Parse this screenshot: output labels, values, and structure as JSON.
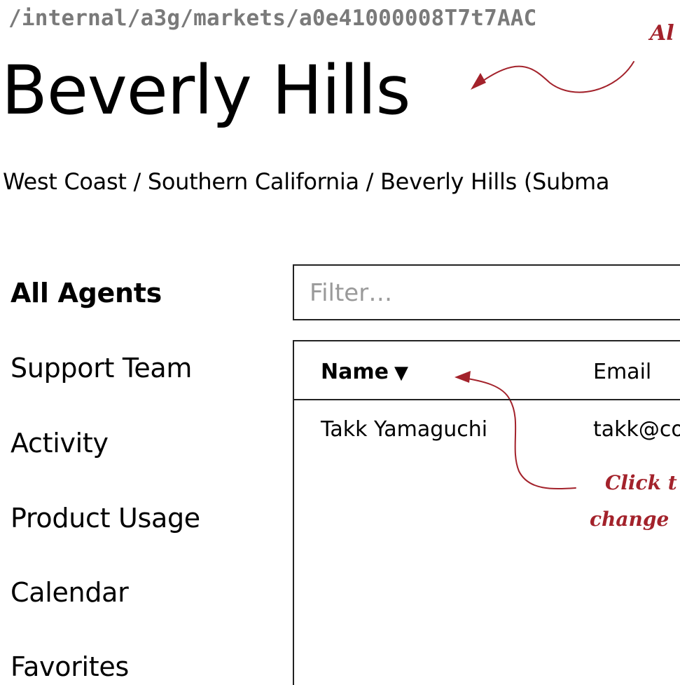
{
  "url_path": "/internal/a3g/markets/a0e41000008T7t7AAC",
  "page_title": "Beverly Hills",
  "breadcrumb": "West Coast / Southern California / Beverly Hills (Subma",
  "annotations": {
    "top": "Al",
    "click_line1": "Click t",
    "click_line2": "change"
  },
  "sidebar": {
    "items": [
      {
        "label": "All Agents",
        "active": true
      },
      {
        "label": "Support Team",
        "active": false
      },
      {
        "label": "Activity",
        "active": false
      },
      {
        "label": "Product Usage",
        "active": false
      },
      {
        "label": "Calendar",
        "active": false
      },
      {
        "label": "Favorites",
        "active": false
      }
    ]
  },
  "filter": {
    "placeholder": "Filter…",
    "value": ""
  },
  "table": {
    "columns": [
      {
        "label": "Name",
        "sort_indicator": "▼"
      },
      {
        "label": "Email"
      }
    ],
    "rows": [
      {
        "name": "Takk Yamaguchi",
        "email": "takk@co"
      }
    ]
  },
  "colors": {
    "annotation": "#a3222b",
    "path_text": "#7a7a7a",
    "placeholder": "#9a9a9a"
  }
}
